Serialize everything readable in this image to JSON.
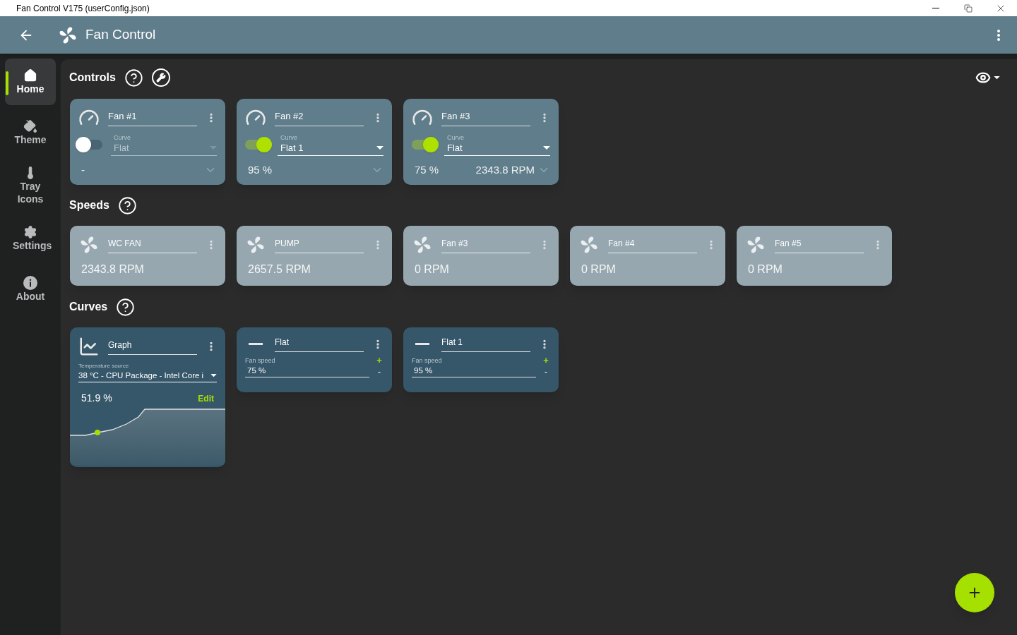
{
  "window": {
    "title": "Fan Control V175 (userConfig.json)"
  },
  "app_bar": {
    "title": "Fan Control"
  },
  "sidebar": {
    "items": [
      {
        "label": "Home",
        "kind": "home",
        "selected": true
      },
      {
        "label": "Theme",
        "kind": "theme",
        "selected": false
      },
      {
        "label": "Tray Icons",
        "kind": "tray",
        "selected": false
      },
      {
        "label": "Settings",
        "kind": "settings",
        "selected": false
      },
      {
        "label": "About",
        "kind": "about",
        "selected": false
      }
    ]
  },
  "sections": {
    "controls": {
      "title": "Controls"
    },
    "speeds": {
      "title": "Speeds"
    },
    "curves": {
      "title": "Curves"
    }
  },
  "controls": [
    {
      "name": "Fan #1",
      "on": false,
      "curve_label": "Curve",
      "curve": "Flat",
      "value": "-"
    },
    {
      "name": "Fan #2",
      "on": true,
      "curve_label": "Curve",
      "curve": "Flat 1",
      "value": "95 %"
    },
    {
      "name": "Fan #3",
      "on": true,
      "curve_label": "Curve",
      "curve": "Flat",
      "value": "75 %",
      "rpm": "2343.8 RPM"
    }
  ],
  "speeds": [
    {
      "name": "WC FAN",
      "reading": "2343.8 RPM"
    },
    {
      "name": "PUMP",
      "reading": "2657.5 RPM"
    },
    {
      "name": "Fan #3",
      "reading": "0 RPM"
    },
    {
      "name": "Fan #4",
      "reading": "0 RPM"
    },
    {
      "name": "Fan #5",
      "reading": "0 RPM"
    }
  ],
  "curves": [
    {
      "kind": "graph",
      "name": "Graph",
      "source_label": "Temperature source",
      "source": "38 °C - CPU Package - Intel Core i",
      "value": "51.9 %",
      "edit": "Edit"
    },
    {
      "kind": "flat",
      "name": "Flat",
      "field_label": "Fan speed",
      "value": "75 %",
      "plus": "+",
      "minus": "-"
    },
    {
      "kind": "flat",
      "name": "Flat 1",
      "field_label": "Fan speed",
      "value": "95 %",
      "plus": "+",
      "minus": "-"
    }
  ]
}
